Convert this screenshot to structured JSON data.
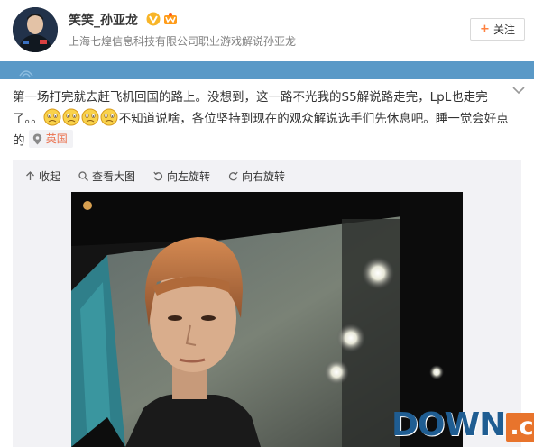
{
  "user": {
    "name": "笑笑_孙亚龙",
    "description": "上海七煌信息科技有限公司职业游戏解说孙亚龙",
    "follow_label": "关注"
  },
  "post": {
    "text_part1": "第一场打完就去赶飞机回国的路上。没想到，这一路不光我的S5解说路走完，LpL也走完了。。",
    "text_part2": "不知道说啥，各位坚持到现在的观众解说选手们先休息吧。睡一觉会好点的",
    "emoji_count": 4,
    "location": "英国"
  },
  "media_toolbar": {
    "collapse": "收起",
    "view_large": "查看大图",
    "rotate_left": "向左旋转",
    "rotate_right": "向右旋转"
  },
  "watermark": {
    "down": "DOWN",
    "cc": ".cc"
  },
  "colors": {
    "accent_orange": "#ff8140",
    "location_text": "#eb7350",
    "banner_blue": "#5a99c7",
    "media_bg": "#f2f2f5"
  },
  "icons": [
    "avatar",
    "verified-v-icon",
    "vip-crown-icon",
    "plus-icon",
    "chevron-down-icon",
    "sad-emoji-icon",
    "location-pin-icon",
    "collapse-arrow-icon",
    "magnify-icon",
    "rotate-left-icon",
    "rotate-right-icon"
  ]
}
